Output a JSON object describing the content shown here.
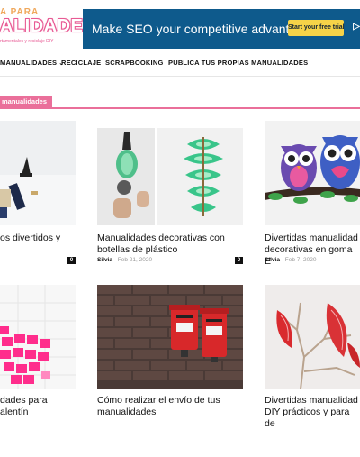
{
  "logo": {
    "top_text": "A PARA",
    "main_text": "ALIDADES",
    "tagline": "rtamentales y reciclaje DIY"
  },
  "ad": {
    "headline": "Make SEO your competitive advantage.",
    "cta": "Start your free trial",
    "info": "▷"
  },
  "nav": {
    "items": [
      {
        "label": "MANUALIDADES",
        "has_dropdown": true
      },
      {
        "label": "RECICLAJE"
      },
      {
        "label": "SCRAPBOOKING"
      },
      {
        "label": "PUBLICA TUS PROPIAS MANUALIDADES"
      }
    ],
    "chevron": "⌄"
  },
  "section": {
    "label": "manualidades"
  },
  "colors": {
    "accent": "#ea6f9a",
    "ad_bg": "#0e5a8c",
    "cta": "#f6d348"
  },
  "posts": [
    {
      "title": "os divertidos y",
      "author": "",
      "date": "",
      "comments": "0",
      "image": "craft-tools-on-white"
    },
    {
      "title": "Manualidades decorativas con botellas de plástico",
      "author": "Silvia",
      "date": "Feb 21, 2020",
      "comments": "0",
      "image": "plastic-bottle-crafts"
    },
    {
      "title": "Divertidas manualidad decorativas en goma E",
      "author": "Silvia",
      "date": "Feb 7, 2020",
      "comments": "",
      "image": "eva-foam-owls"
    },
    {
      "title": "dades para alentín",
      "author": "",
      "date": "",
      "comments": "",
      "image": "pink-sticky-notes-heart"
    },
    {
      "title": "Cómo realizar el envío de tus manualidades",
      "author": "",
      "date": "",
      "comments": "",
      "image": "red-postboxes-brick-wall"
    },
    {
      "title": "Divertidas manualidad DIY prácticos y para de",
      "author": "",
      "date": "",
      "comments": "",
      "image": "paper-hearts-branches"
    }
  ],
  "meta_separator": "-"
}
